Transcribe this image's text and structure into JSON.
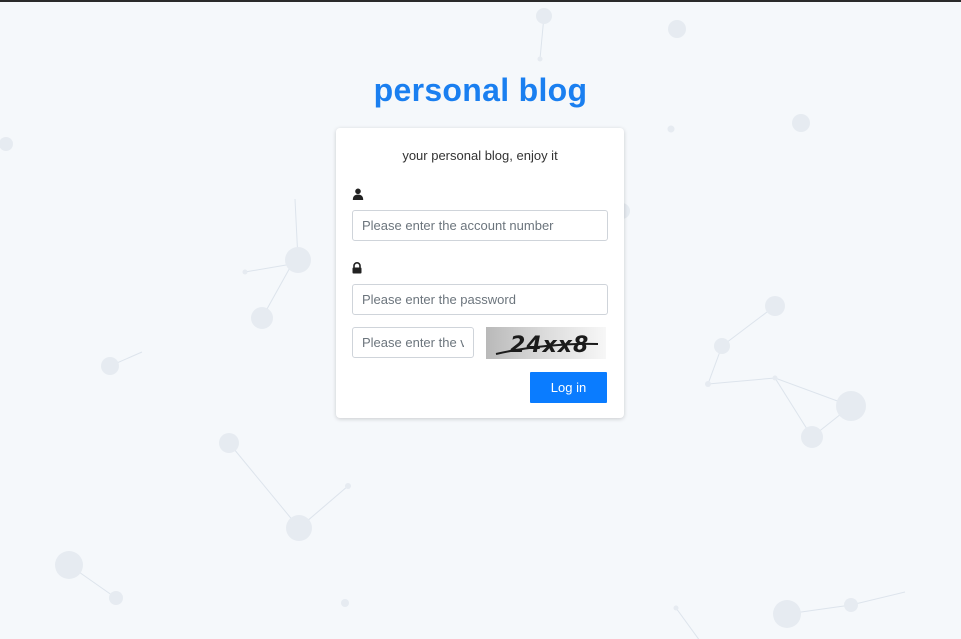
{
  "page": {
    "title": "personal blog",
    "subtitle": "your personal blog, enjoy it"
  },
  "form": {
    "account": {
      "icon": "user-icon",
      "placeholder": "Please enter the account number",
      "value": ""
    },
    "password": {
      "icon": "lock-icon",
      "placeholder": "Please enter the password",
      "value": ""
    },
    "verification": {
      "placeholder": "Please enter the verification code",
      "value": ""
    },
    "captcha_text": "24xx8",
    "login_label": "Log in"
  },
  "colors": {
    "title": "#1a7ff0",
    "button": "#0a7cff",
    "background": "#f5f8fb"
  }
}
